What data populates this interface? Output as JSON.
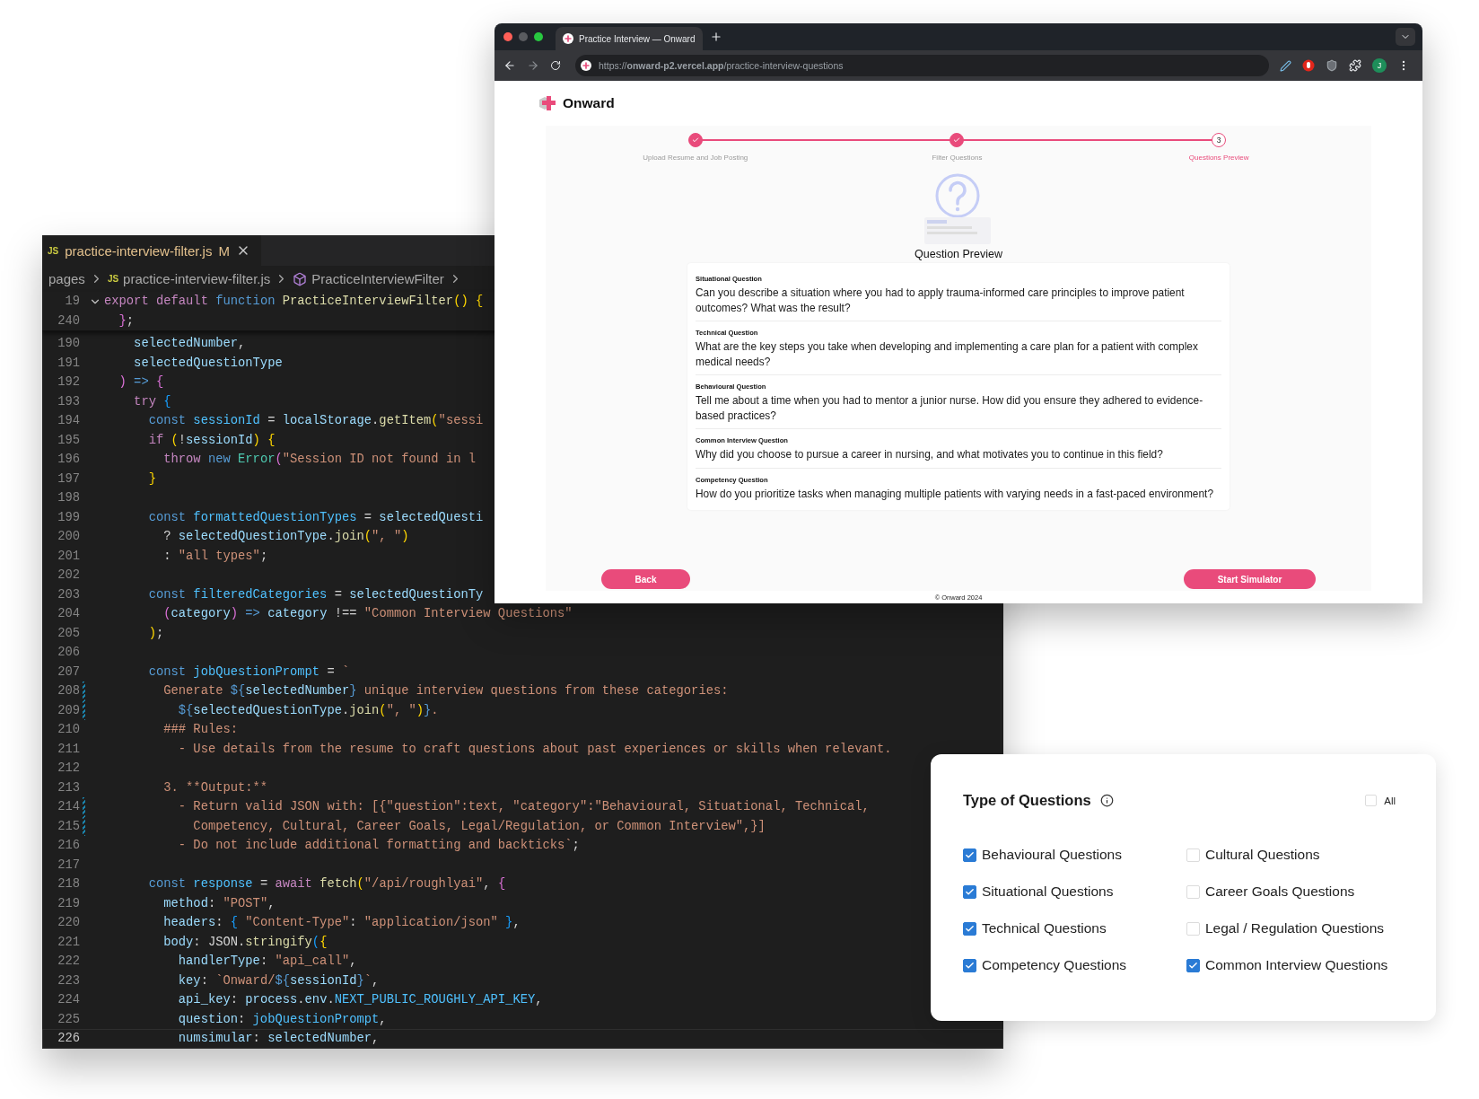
{
  "editor": {
    "tab": {
      "icon_text": "JS",
      "filename": "practice-interview-filter.js",
      "badge": "M"
    },
    "breadcrumb": {
      "folder": "pages",
      "file_icon_text": "JS",
      "file": "practice-interview-filter.js",
      "symbol": "PracticeInterviewFilter"
    },
    "sticky_lines": [
      {
        "n": "19",
        "tokens": [
          {
            "kind": "ctl",
            "text": "export default "
          },
          {
            "kind": "kw",
            "text": "function "
          },
          {
            "kind": "fn",
            "text": "PracticeInterviewFilter"
          },
          {
            "kind": "br",
            "text": "() {"
          }
        ]
      },
      {
        "n": "240",
        "tokens": [
          {
            "kind": "br2",
            "text": "  }"
          },
          {
            "kind": "plain",
            "text": ";"
          }
        ]
      }
    ],
    "lines": [
      {
        "n": "190",
        "modified": false,
        "current": false,
        "tokens": [
          {
            "kind": "var",
            "text": "    selectedNumber"
          },
          {
            "kind": "plain",
            "text": ","
          }
        ]
      },
      {
        "n": "191",
        "modified": false,
        "current": false,
        "tokens": [
          {
            "kind": "var",
            "text": "    selectedQuestionType"
          }
        ]
      },
      {
        "n": "192",
        "modified": false,
        "current": false,
        "tokens": [
          {
            "kind": "br2",
            "text": "  )"
          },
          {
            "kind": "kw",
            "text": " => "
          },
          {
            "kind": "br2",
            "text": "{"
          }
        ]
      },
      {
        "n": "193",
        "modified": false,
        "current": false,
        "tokens": [
          {
            "kind": "ctl",
            "text": "    try "
          },
          {
            "kind": "br3",
            "text": "{"
          }
        ]
      },
      {
        "n": "194",
        "modified": false,
        "current": false,
        "tokens": [
          {
            "kind": "kw",
            "text": "      const "
          },
          {
            "kind": "const",
            "text": "sessionId"
          },
          {
            "kind": "plain",
            "text": " = "
          },
          {
            "kind": "var",
            "text": "localStorage"
          },
          {
            "kind": "plain",
            "text": "."
          },
          {
            "kind": "fn",
            "text": "getItem"
          },
          {
            "kind": "br",
            "text": "("
          },
          {
            "kind": "str",
            "text": "\"sessi"
          }
        ]
      },
      {
        "n": "195",
        "modified": false,
        "current": false,
        "tokens": [
          {
            "kind": "ctl",
            "text": "      if "
          },
          {
            "kind": "br",
            "text": "("
          },
          {
            "kind": "plain",
            "text": "!"
          },
          {
            "kind": "var",
            "text": "sessionId"
          },
          {
            "kind": "br",
            "text": ")"
          },
          {
            "kind": "br",
            "text": " {"
          }
        ]
      },
      {
        "n": "196",
        "modified": false,
        "current": false,
        "tokens": [
          {
            "kind": "ctl",
            "text": "        throw "
          },
          {
            "kind": "kw",
            "text": "new "
          },
          {
            "kind": "cls",
            "text": "Error"
          },
          {
            "kind": "br2",
            "text": "("
          },
          {
            "kind": "str",
            "text": "\"Session ID not found in l"
          }
        ]
      },
      {
        "n": "197",
        "modified": false,
        "current": false,
        "tokens": [
          {
            "kind": "br",
            "text": "      }"
          }
        ]
      },
      {
        "n": "198",
        "modified": false,
        "current": false
      },
      {
        "n": "199",
        "modified": false,
        "current": false,
        "tokens": [
          {
            "kind": "kw",
            "text": "      const "
          },
          {
            "kind": "const",
            "text": "formattedQuestionTypes"
          },
          {
            "kind": "plain",
            "text": " = "
          },
          {
            "kind": "var",
            "text": "selectedQuesti"
          }
        ]
      },
      {
        "n": "200",
        "modified": false,
        "current": false,
        "tokens": [
          {
            "kind": "plain",
            "text": "        ? "
          },
          {
            "kind": "var",
            "text": "selectedQuestionType"
          },
          {
            "kind": "plain",
            "text": "."
          },
          {
            "kind": "fn",
            "text": "join"
          },
          {
            "kind": "br",
            "text": "("
          },
          {
            "kind": "str",
            "text": "\", \""
          },
          {
            "kind": "br",
            "text": ")"
          }
        ]
      },
      {
        "n": "201",
        "modified": false,
        "current": false,
        "tokens": [
          {
            "kind": "plain",
            "text": "        : "
          },
          {
            "kind": "str",
            "text": "\"all types\""
          },
          {
            "kind": "plain",
            "text": ";"
          }
        ]
      },
      {
        "n": "202",
        "modified": false,
        "current": false
      },
      {
        "n": "203",
        "modified": false,
        "current": false,
        "tokens": [
          {
            "kind": "kw",
            "text": "      const "
          },
          {
            "kind": "const",
            "text": "filteredCategories"
          },
          {
            "kind": "plain",
            "text": " = "
          },
          {
            "kind": "var",
            "text": "selectedQuestionTy"
          }
        ]
      },
      {
        "n": "204",
        "modified": false,
        "current": false,
        "tokens": [
          {
            "kind": "br2",
            "text": "        ("
          },
          {
            "kind": "var",
            "text": "category"
          },
          {
            "kind": "br2",
            "text": ")"
          },
          {
            "kind": "kw",
            "text": " => "
          },
          {
            "kind": "var",
            "text": "category"
          },
          {
            "kind": "plain",
            "text": " !== "
          },
          {
            "kind": "str",
            "text": "\"Common Interview Questions\""
          }
        ]
      },
      {
        "n": "205",
        "modified": false,
        "current": false,
        "tokens": [
          {
            "kind": "br",
            "text": "      )"
          },
          {
            "kind": "plain",
            "text": ";"
          }
        ]
      },
      {
        "n": "206",
        "modified": false,
        "current": false
      },
      {
        "n": "207",
        "modified": false,
        "current": false,
        "tokens": [
          {
            "kind": "kw",
            "text": "      const "
          },
          {
            "kind": "const",
            "text": "jobQuestionPrompt"
          },
          {
            "kind": "plain",
            "text": " = "
          },
          {
            "kind": "str",
            "text": "`"
          }
        ]
      },
      {
        "n": "208",
        "modified": true,
        "current": false,
        "tokens": [
          {
            "kind": "str",
            "text": "        Generate "
          },
          {
            "kind": "kw",
            "text": "${"
          },
          {
            "kind": "var",
            "text": "selectedNumber"
          },
          {
            "kind": "kw",
            "text": "}"
          },
          {
            "kind": "str",
            "text": " unique interview questions from these categories:"
          }
        ]
      },
      {
        "n": "209",
        "modified": true,
        "current": false,
        "tokens": [
          {
            "kind": "kw",
            "text": "          ${"
          },
          {
            "kind": "var",
            "text": "selectedQuestionType"
          },
          {
            "kind": "plain",
            "text": "."
          },
          {
            "kind": "fn",
            "text": "join"
          },
          {
            "kind": "br",
            "text": "("
          },
          {
            "kind": "str",
            "text": "\", \""
          },
          {
            "kind": "br",
            "text": ")"
          },
          {
            "kind": "kw",
            "text": "}"
          },
          {
            "kind": "str",
            "text": "."
          }
        ]
      },
      {
        "n": "210",
        "modified": false,
        "current": false,
        "tokens": [
          {
            "kind": "str",
            "text": "        ### Rules:"
          }
        ]
      },
      {
        "n": "211",
        "modified": false,
        "current": false,
        "tokens": [
          {
            "kind": "str",
            "text": "          - Use details from the resume to craft questions about past experiences or skills when relevant."
          }
        ]
      },
      {
        "n": "212",
        "modified": false,
        "current": false
      },
      {
        "n": "213",
        "modified": false,
        "current": false,
        "tokens": [
          {
            "kind": "str",
            "text": "        3. **Output:**"
          }
        ]
      },
      {
        "n": "214",
        "modified": true,
        "current": false,
        "tokens": [
          {
            "kind": "str",
            "text": "          - Return valid JSON with: [{\"question\":text, \"category\":\"Behavioural, Situational, Technical,"
          }
        ]
      },
      {
        "n": "215",
        "modified": true,
        "current": false,
        "tokens": [
          {
            "kind": "str",
            "text": "            Competency, Cultural, Career Goals, Legal/Regulation, or Common Interview\",}]"
          }
        ]
      },
      {
        "n": "216",
        "modified": false,
        "current": false,
        "tokens": [
          {
            "kind": "str",
            "text": "          - Do not include additional formatting and backticks`"
          },
          {
            "kind": "plain",
            "text": ";"
          }
        ]
      },
      {
        "n": "217",
        "modified": false,
        "current": false
      },
      {
        "n": "218",
        "modified": false,
        "current": false,
        "tokens": [
          {
            "kind": "kw",
            "text": "      const "
          },
          {
            "kind": "const",
            "text": "response"
          },
          {
            "kind": "plain",
            "text": " = "
          },
          {
            "kind": "ctl",
            "text": "await "
          },
          {
            "kind": "fn",
            "text": "fetch"
          },
          {
            "kind": "br",
            "text": "("
          },
          {
            "kind": "str",
            "text": "\"/api/roughlyai\""
          },
          {
            "kind": "plain",
            "text": ", "
          },
          {
            "kind": "br2",
            "text": "{"
          }
        ]
      },
      {
        "n": "219",
        "modified": false,
        "current": false,
        "tokens": [
          {
            "kind": "var",
            "text": "        method"
          },
          {
            "kind": "plain",
            "text": ": "
          },
          {
            "kind": "str",
            "text": "\"POST\""
          },
          {
            "kind": "plain",
            "text": ","
          }
        ]
      },
      {
        "n": "220",
        "modified": false,
        "current": false,
        "tokens": [
          {
            "kind": "var",
            "text": "        headers"
          },
          {
            "kind": "plain",
            "text": ": "
          },
          {
            "kind": "br3",
            "text": "{ "
          },
          {
            "kind": "str",
            "text": "\"Content-Type\""
          },
          {
            "kind": "plain",
            "text": ": "
          },
          {
            "kind": "str",
            "text": "\"application/json\""
          },
          {
            "kind": "br3",
            "text": " }"
          },
          {
            "kind": "plain",
            "text": ","
          }
        ]
      },
      {
        "n": "221",
        "modified": false,
        "current": false,
        "tokens": [
          {
            "kind": "var",
            "text": "        body"
          },
          {
            "kind": "plain",
            "text": ": JSON."
          },
          {
            "kind": "fn",
            "text": "stringify"
          },
          {
            "kind": "br3",
            "text": "("
          },
          {
            "kind": "br",
            "text": "{"
          }
        ]
      },
      {
        "n": "222",
        "modified": false,
        "current": false,
        "tokens": [
          {
            "kind": "var",
            "text": "          handlerType"
          },
          {
            "kind": "plain",
            "text": ": "
          },
          {
            "kind": "str",
            "text": "\"api_call\""
          },
          {
            "kind": "plain",
            "text": ","
          }
        ]
      },
      {
        "n": "223",
        "modified": false,
        "current": false,
        "tokens": [
          {
            "kind": "var",
            "text": "          key"
          },
          {
            "kind": "plain",
            "text": ": "
          },
          {
            "kind": "str",
            "text": "`Onward/"
          },
          {
            "kind": "kw",
            "text": "${"
          },
          {
            "kind": "var",
            "text": "sessionId"
          },
          {
            "kind": "kw",
            "text": "}"
          },
          {
            "kind": "str",
            "text": "`"
          },
          {
            "kind": "plain",
            "text": ","
          }
        ]
      },
      {
        "n": "224",
        "modified": false,
        "current": false,
        "tokens": [
          {
            "kind": "var",
            "text": "          api_key"
          },
          {
            "kind": "plain",
            "text": ": "
          },
          {
            "kind": "var",
            "text": "process"
          },
          {
            "kind": "plain",
            "text": "."
          },
          {
            "kind": "var",
            "text": "env"
          },
          {
            "kind": "plain",
            "text": "."
          },
          {
            "kind": "const",
            "text": "NEXT_PUBLIC_ROUGHLY_API_KEY"
          },
          {
            "kind": "plain",
            "text": ","
          }
        ]
      },
      {
        "n": "225",
        "modified": false,
        "current": false,
        "tokens": [
          {
            "kind": "var",
            "text": "          question"
          },
          {
            "kind": "plain",
            "text": ": "
          },
          {
            "kind": "const",
            "text": "jobQuestionPrompt"
          },
          {
            "kind": "plain",
            "text": ","
          }
        ]
      },
      {
        "n": "226",
        "modified": false,
        "current": true,
        "tokens": [
          {
            "kind": "var",
            "text": "          numsimular"
          },
          {
            "kind": "plain",
            "text": ": "
          },
          {
            "kind": "var",
            "text": "selectedNumber"
          },
          {
            "kind": "plain",
            "text": ","
          }
        ]
      }
    ]
  },
  "browser": {
    "tab_title": "Practice Interview — Onward",
    "url": "https://**onward-p2.vercel.app**/practice-interview-questions",
    "avatar": "J"
  },
  "app": {
    "brand": "Onward",
    "steps": [
      {
        "label": "Upload Resume and Job Posting",
        "completed": true,
        "selected": false
      },
      {
        "label": "Filter Questions",
        "completed": true,
        "selected": false
      },
      {
        "label": "Questions Preview",
        "completed": false,
        "selected": true,
        "marker": "3"
      }
    ],
    "preview_title": "Question Preview",
    "questions": [
      {
        "category": "Situational Question",
        "text": "Can you describe a situation where you had to apply trauma-informed care principles to improve patient outcomes? What was the result?"
      },
      {
        "category": "Technical Question",
        "text": "What are the key steps you take when developing and implementing a care plan for a patient with complex medical needs?"
      },
      {
        "category": "Behavioural Question",
        "text": "Tell me about a time when you had to mentor a junior nurse. How did you ensure they adhered to evidence-based practices?"
      },
      {
        "category": "Common Interview Question",
        "text": "Why did you choose to pursue a career in nursing, and what motivates you to continue in this field?"
      },
      {
        "category": "Competency Question",
        "text": "How do you prioritize tasks when managing multiple patients with varying needs in a fast-paced environment?"
      }
    ],
    "back_button": "Back",
    "start_button": "Start Simulator",
    "footer": "© Onward 2024"
  },
  "filter": {
    "title": "Type of Questions",
    "all": {
      "label": "All",
      "checked": false
    },
    "options": [
      {
        "label": "Behavioural Questions",
        "checked": true
      },
      {
        "label": "Cultural Questions",
        "checked": false
      },
      {
        "label": "Situational Questions",
        "checked": true
      },
      {
        "label": "Career Goals Questions",
        "checked": false
      },
      {
        "label": "Technical Questions",
        "checked": true
      },
      {
        "label": "Legal / Regulation Questions",
        "checked": false
      },
      {
        "label": "Competency Questions",
        "checked": true
      },
      {
        "label": "Common Interview Questions",
        "checked": true
      }
    ]
  }
}
